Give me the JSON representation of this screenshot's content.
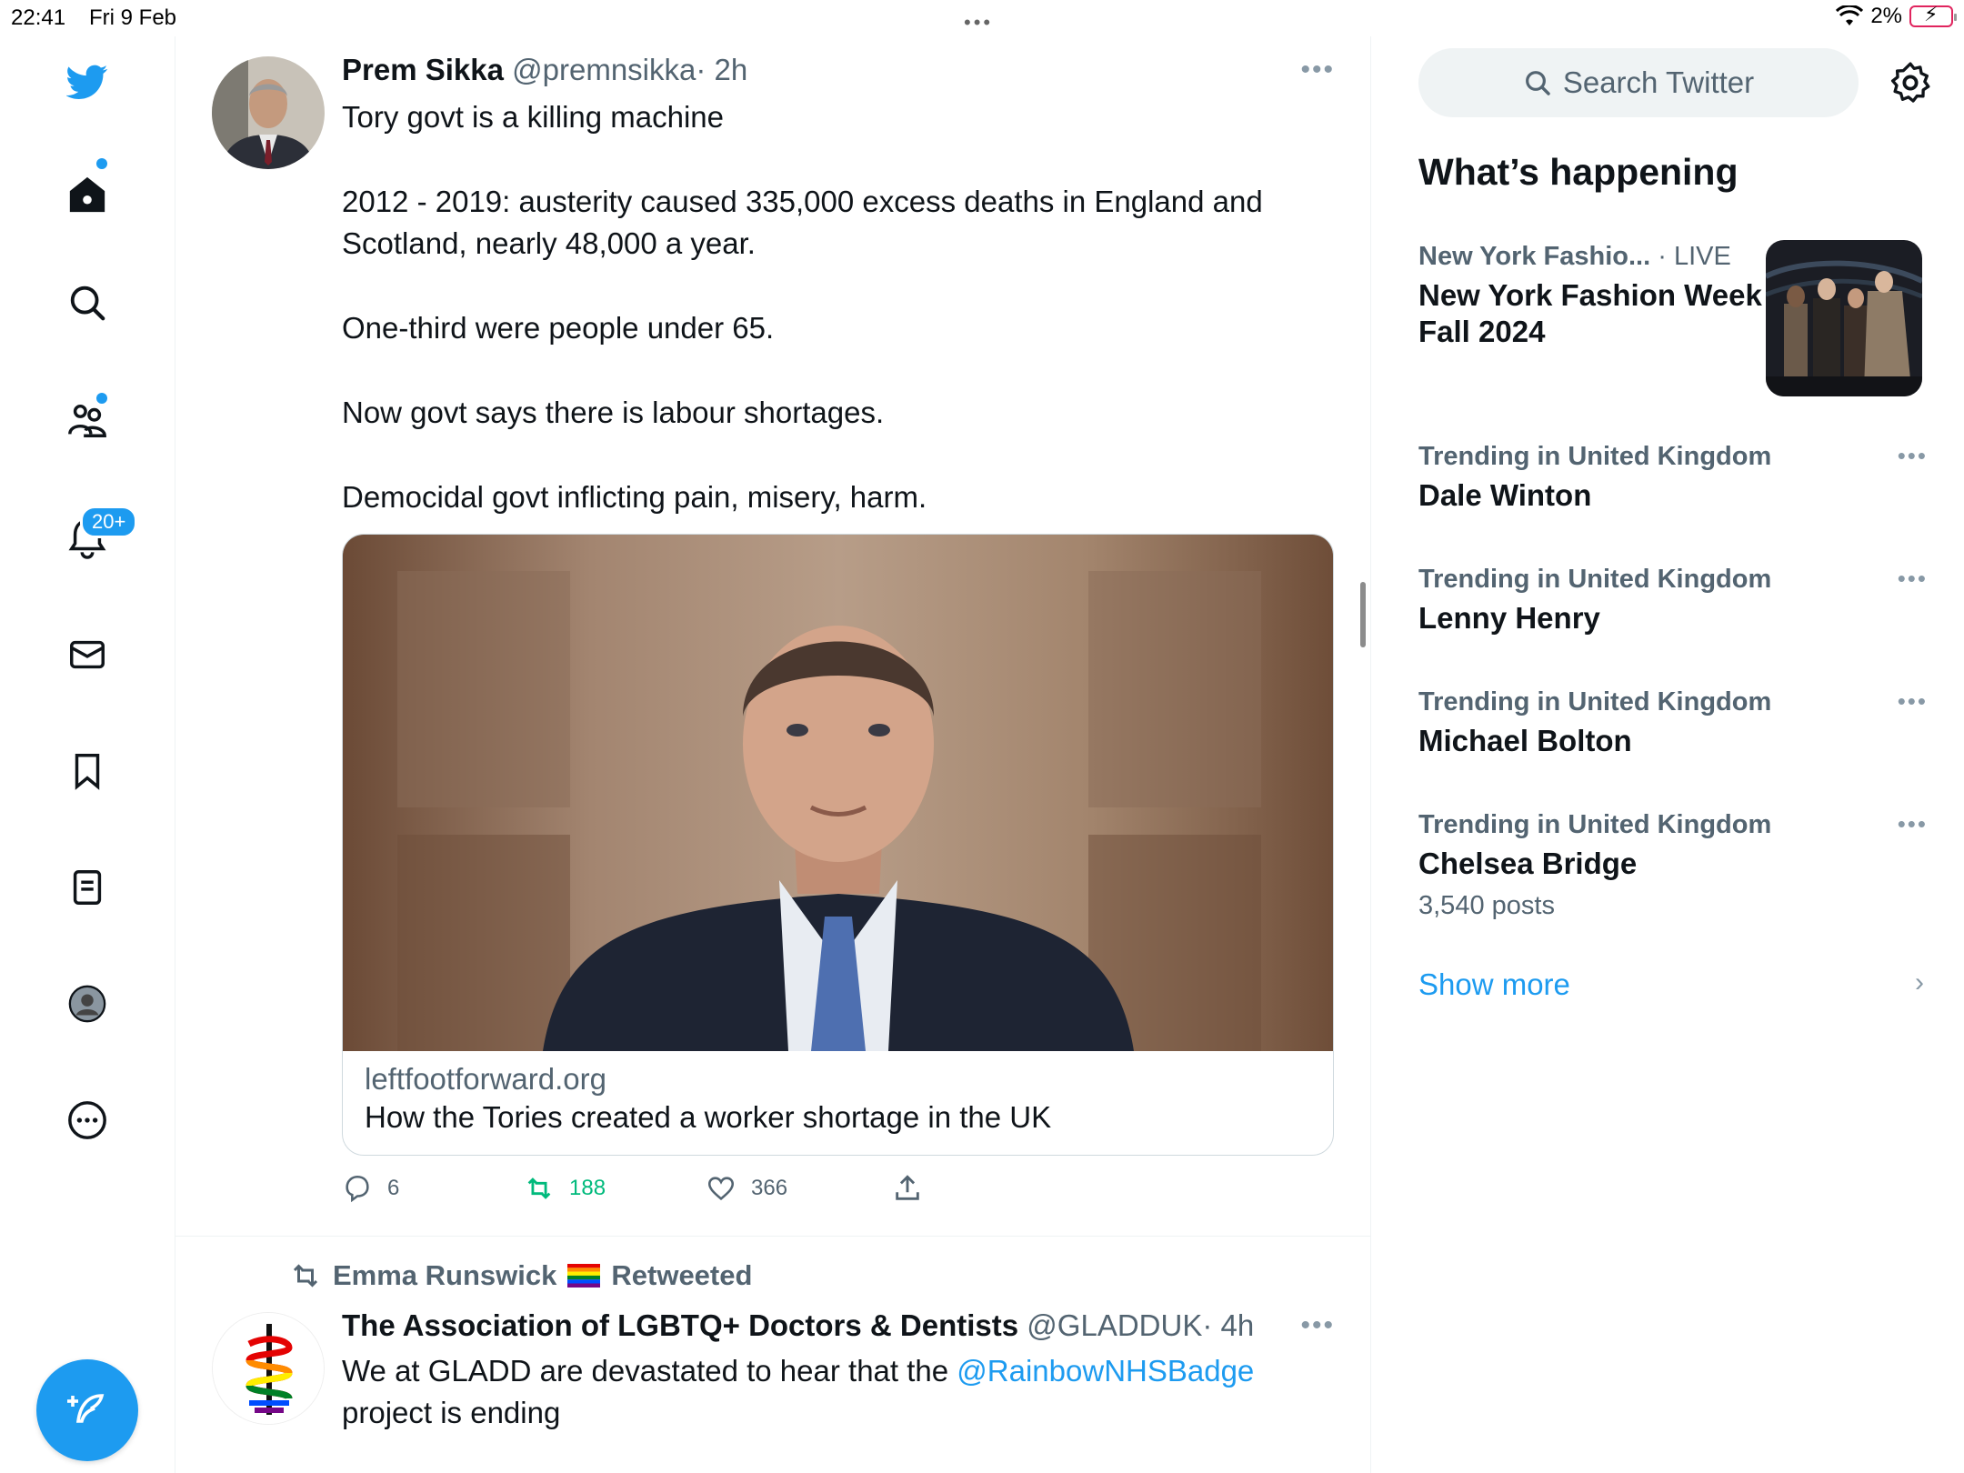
{
  "status_bar": {
    "time": "22:41",
    "date": "Fri 9 Feb",
    "battery": "2%"
  },
  "nav": {
    "notifications_badge": "20+",
    "items": [
      "home",
      "explore",
      "communities",
      "notifications",
      "messages",
      "bookmarks",
      "lists",
      "profile",
      "more"
    ]
  },
  "tweet1": {
    "name": "Prem Sikka",
    "handle": "@premnsikka",
    "time": "· 2h",
    "lines": [
      "Tory govt is a killing machine",
      "2012 - 2019: austerity caused 335,000 excess deaths in England and Scotland, nearly 48,000 a year.",
      "One-third were people under 65.",
      "Now govt says there is labour shortages.",
      "Democidal govt inflicting pain, misery, harm."
    ],
    "card": {
      "domain": "leftfootforward.org",
      "title": "How the Tories created a worker shortage in the UK"
    },
    "replies": "6",
    "retweets": "188",
    "likes": "366"
  },
  "tweet2": {
    "retweeted_by": "Emma Runswick",
    "retweeted_label": "Retweeted",
    "name": "The Association of LGBTQ+ Doctors & Dentists",
    "handle": "@GLADDUK",
    "time": "· 4h",
    "text_before": "We at GLADD are devastated to hear that the ",
    "mention": "@RainbowNHSBadge",
    "text_after": "project is ending"
  },
  "sidebar": {
    "search_placeholder": "Search Twitter",
    "title": "What’s happening",
    "featured": {
      "category": "New York Fashio...",
      "live": "· LIVE",
      "topic": "New York Fashion Week Fall 2024"
    },
    "trends": [
      {
        "category": "Trending in United Kingdom",
        "topic": "Dale Winton",
        "count": ""
      },
      {
        "category": "Trending in United Kingdom",
        "topic": "Lenny Henry",
        "count": ""
      },
      {
        "category": "Trending in United Kingdom",
        "topic": "Michael Bolton",
        "count": ""
      },
      {
        "category": "Trending in United Kingdom",
        "topic": "Chelsea Bridge",
        "count": "3,540 posts"
      }
    ],
    "show_more": "Show more"
  },
  "colors": {
    "accent": "#1d9bf0",
    "retweet": "#00ba7c",
    "muted": "#536471"
  }
}
